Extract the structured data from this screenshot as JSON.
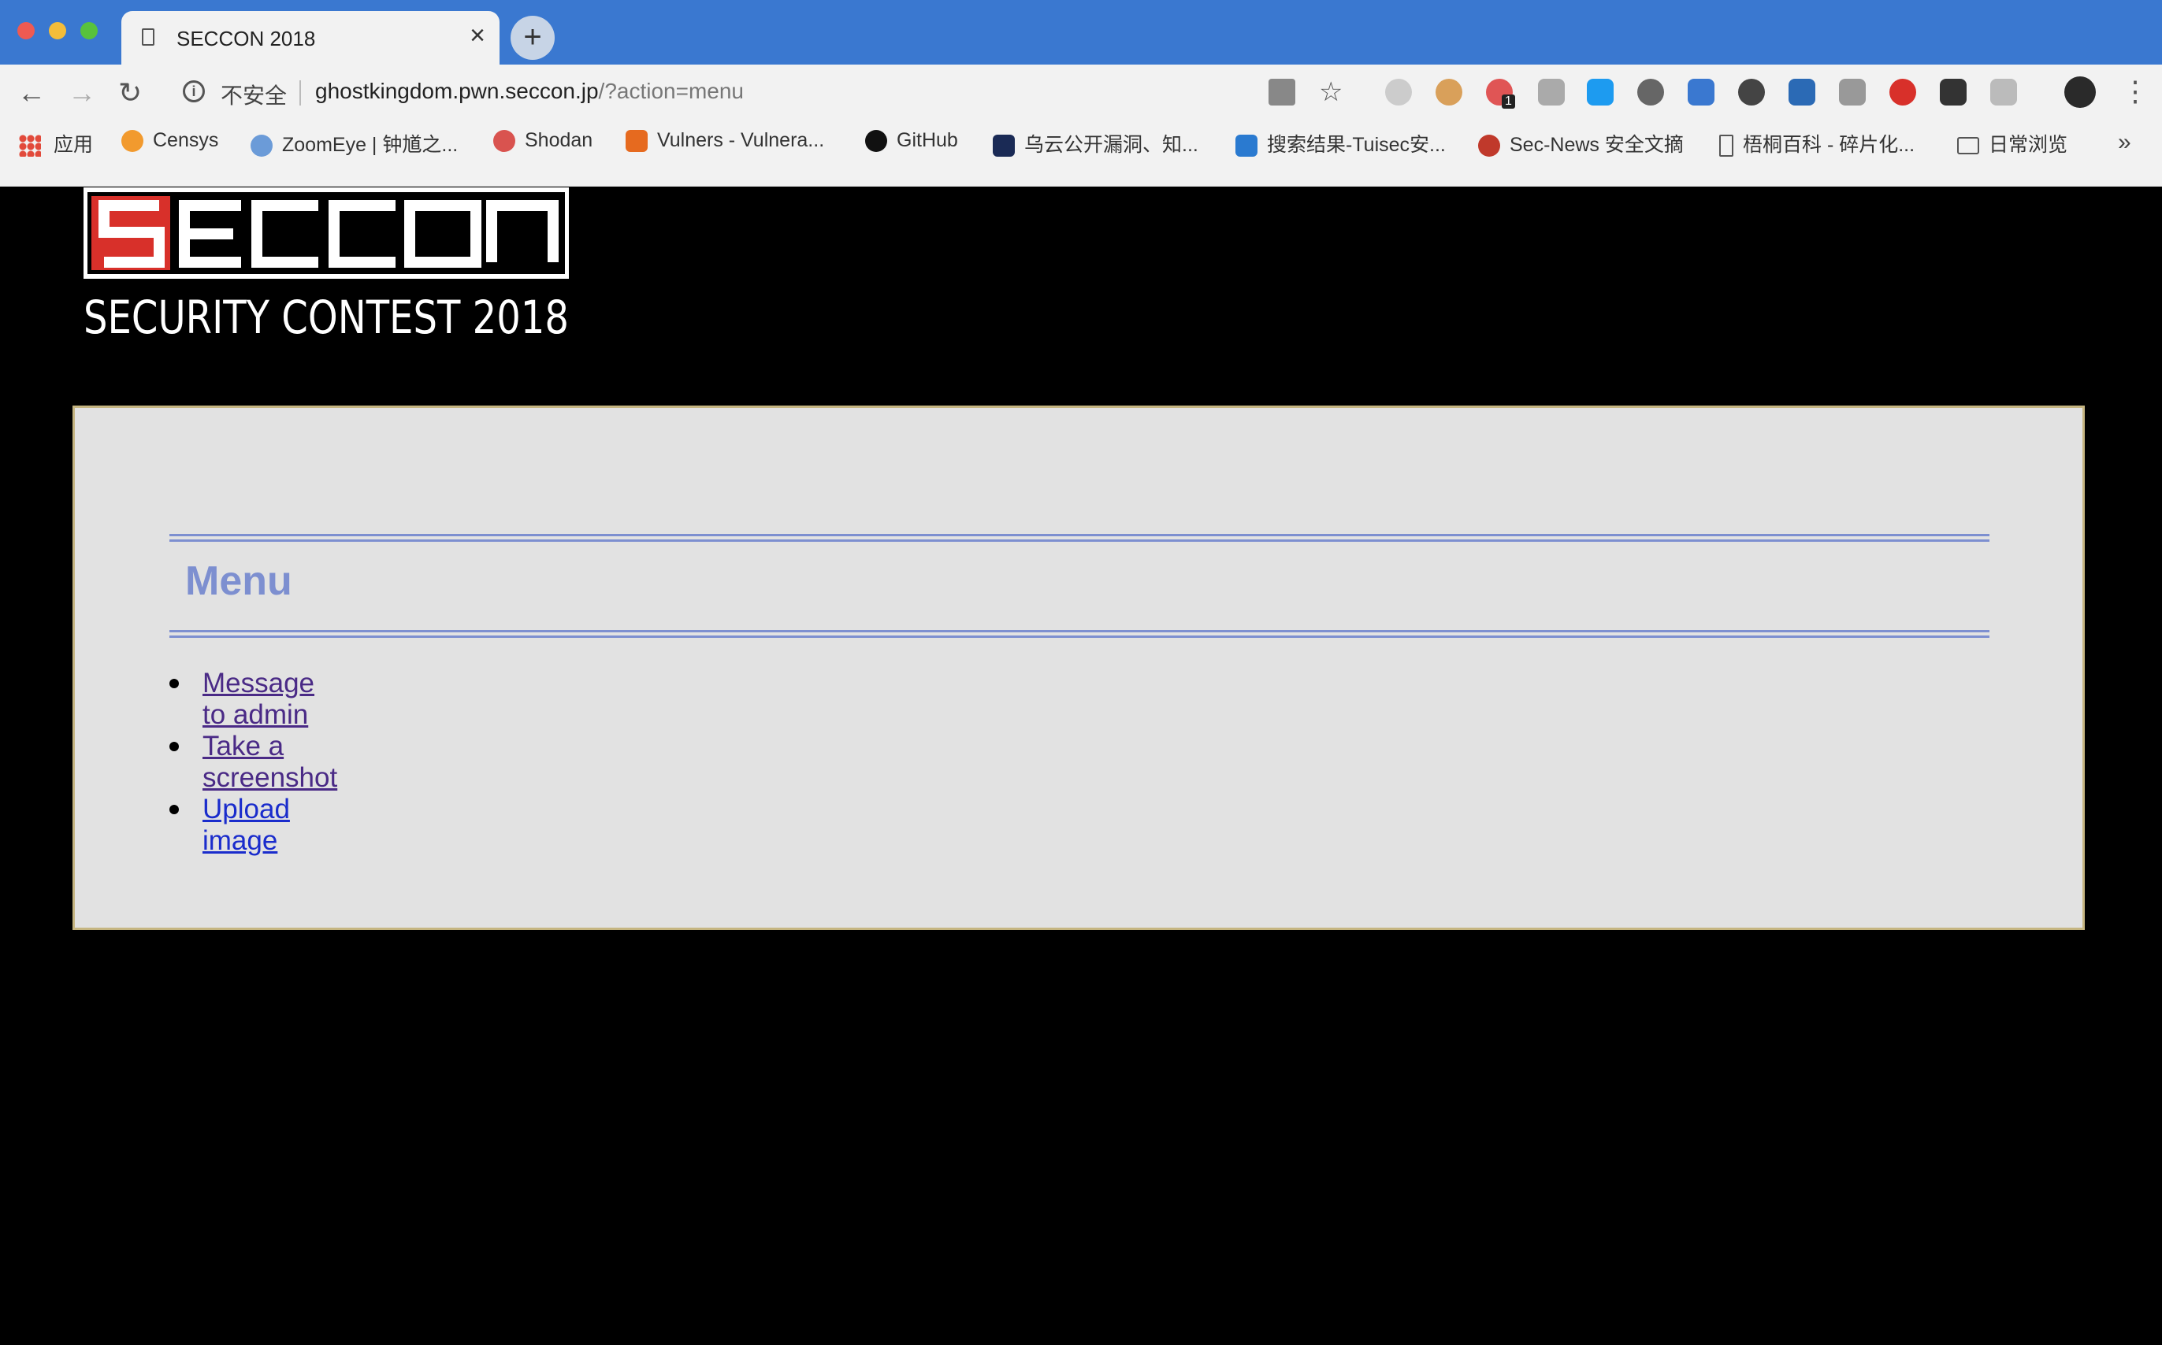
{
  "browser": {
    "tab_title": "SECCON 2018",
    "tab_close": "×",
    "new_tab": "+",
    "security_label": "不安全",
    "url_host": "ghostkingdom.pwn.seccon.jp",
    "url_query": "/?action=menu",
    "nav": {
      "back": "←",
      "forward": "→",
      "reload": "↻"
    },
    "more_menu": "⋮",
    "bookmarks": [
      {
        "label": "应用",
        "icon": "apps-icon"
      },
      {
        "label": "Censys",
        "icon": "censys-icon"
      },
      {
        "label": "ZoomEye | 钟馗之...",
        "icon": "zoomeye-icon"
      },
      {
        "label": "Shodan",
        "icon": "shodan-icon"
      },
      {
        "label": "Vulners - Vulnera...",
        "icon": "vulners-icon"
      },
      {
        "label": "GitHub",
        "icon": "github-icon"
      },
      {
        "label": "乌云公开漏洞、知...",
        "icon": "wooyun-icon"
      },
      {
        "label": "搜索结果-Tuisec安...",
        "icon": "tuisec-icon"
      },
      {
        "label": "Sec-News 安全文摘",
        "icon": "secnews-icon"
      },
      {
        "label": "梧桐百科 - 碎片化...",
        "icon": "page-icon"
      },
      {
        "label": "日常浏览",
        "icon": "folder-icon"
      }
    ],
    "bookmarks_more": "»",
    "extension_badge": "1"
  },
  "logo": {
    "brand_first": "S",
    "brand_rest": "ECCON",
    "subtitle": "SECURITY CONTEST 2018"
  },
  "menu": {
    "heading": "Menu",
    "items": [
      {
        "label": "Message to admin"
      },
      {
        "label": "Take a screenshot"
      },
      {
        "label": "Upload image"
      }
    ]
  },
  "colors": {
    "accent": "#7d8fd0",
    "panel_bg": "#e2e2e2",
    "panel_border": "#c5b581",
    "visited_link": "#4a2a86",
    "link": "#1a2ccc",
    "logo_red": "#d8302a"
  }
}
